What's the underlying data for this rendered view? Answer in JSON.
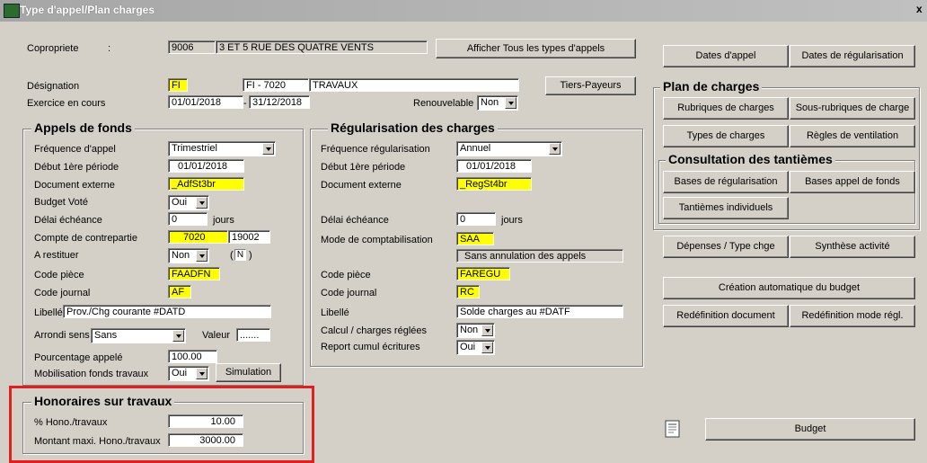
{
  "window": {
    "title": "Type d'appel/Plan charges",
    "close": "x"
  },
  "top": {
    "copro_label": "Copropriete",
    "copro_colon": ":",
    "copro_code": "9006",
    "copro_name": "3 ET 5 RUE DES QUATRE VENTS",
    "btn_afficher": "Afficher Tous les types d'appels",
    "designation_label": "Désignation",
    "designation_code": "FI",
    "designation_ref": "FI - 7020",
    "designation_name": "TRAVAUX",
    "btn_tiers": "Tiers-Payeurs",
    "exercice_label": "Exercice en cours",
    "exercice_start": "01/01/2018",
    "exercice_sep": "-",
    "exercice_end": "31/12/2018",
    "renouvelable_label": "Renouvelable",
    "renouvelable_value": "Non"
  },
  "appels": {
    "title": "Appels de fonds",
    "freq_label": "Fréquence d'appel",
    "freq_value": "Trimestriel",
    "debut_label": "Début 1ère période",
    "debut_value": "01/01/2018",
    "doc_label": "Document externe",
    "doc_value": "_AdfSt3br",
    "budget_label": "Budget Voté",
    "budget_value": "Oui",
    "delai_label": "Délai échéance",
    "delai_value": "0",
    "delai_unit": "jours",
    "compte_label": "Compte de contrepartie",
    "compte_value1": "7020",
    "compte_value2": "19002",
    "restituer_label": "A restituer",
    "restituer_value": "Non",
    "restituer_n": "N",
    "codepiece_label": "Code pièce",
    "codepiece_value": "FAADFN",
    "codejournal_label": "Code journal",
    "codejournal_value": "AF",
    "libelle_label": "Libellé",
    "libelle_value": "Prov./Chg courante #DATD",
    "arrondi_label": "Arrondi sens",
    "arrondi_value": "Sans",
    "valeur_label": "Valeur",
    "valeur_value": ".......",
    "pourcentage_label": "Pourcentage appelé",
    "pourcentage_value": "100.00",
    "mobilisation_label": "Mobilisation fonds travaux",
    "mobilisation_value": "Oui",
    "btn_simulation": "Simulation"
  },
  "regul": {
    "title": "Régularisation des charges",
    "freq_label": "Fréquence régularisation",
    "freq_value": "Annuel",
    "debut_label": "Début 1ère période",
    "debut_value": "01/01/2018",
    "doc_label": "Document externe",
    "doc_value": "_RegSt4br",
    "delai_label": "Délai échéance",
    "delai_value": "0",
    "delai_unit": "jours",
    "mode_label": "Mode de comptabilisation",
    "mode_value": "SAA",
    "mode_desc": "Sans annulation des appels",
    "codepiece_label": "Code pièce",
    "codepiece_value": "FAREGU",
    "codejournal_label": "Code journal",
    "codejournal_value": "RC",
    "libelle_label": "Libellé",
    "libelle_value": "Solde charges au #DATF",
    "calcul_label": "Calcul / charges réglées",
    "calcul_value": "Non",
    "report_label": "Report cumul écritures",
    "report_value": "Oui"
  },
  "honoraires": {
    "title": "Honoraires sur travaux",
    "hono_label": "% Hono./travaux",
    "hono_value": "10.00",
    "max_label": "Montant maxi. Hono./travaux",
    "max_value": "3000.00"
  },
  "right": {
    "btn_dates_appel": "Dates d'appel",
    "btn_dates_regul": "Dates de régularisation",
    "plan_title": "Plan de charges",
    "btn_rubriques": "Rubriques de charges",
    "btn_sousrubriques": "Sous-rubriques de charge",
    "btn_types": "Types de charges",
    "btn_regles": "Règles de ventilation",
    "consult_title": "Consultation des tantièmes",
    "btn_bases_regul": "Bases de régularisation",
    "btn_bases_appel": "Bases appel de fonds",
    "btn_tantiemes": "Tantièmes individuels",
    "btn_depenses": "Dépenses / Type chge",
    "btn_synthese": "Synthèse activité",
    "btn_creation": "Création automatique du budget",
    "btn_redef_doc": "Redéfinition document",
    "btn_redef_mode": "Redéfinition mode régl.",
    "btn_budget": "Budget"
  },
  "colors": {
    "highlight": "#ffff00",
    "annotation": "#e02020",
    "face": "#d4d0c8"
  }
}
